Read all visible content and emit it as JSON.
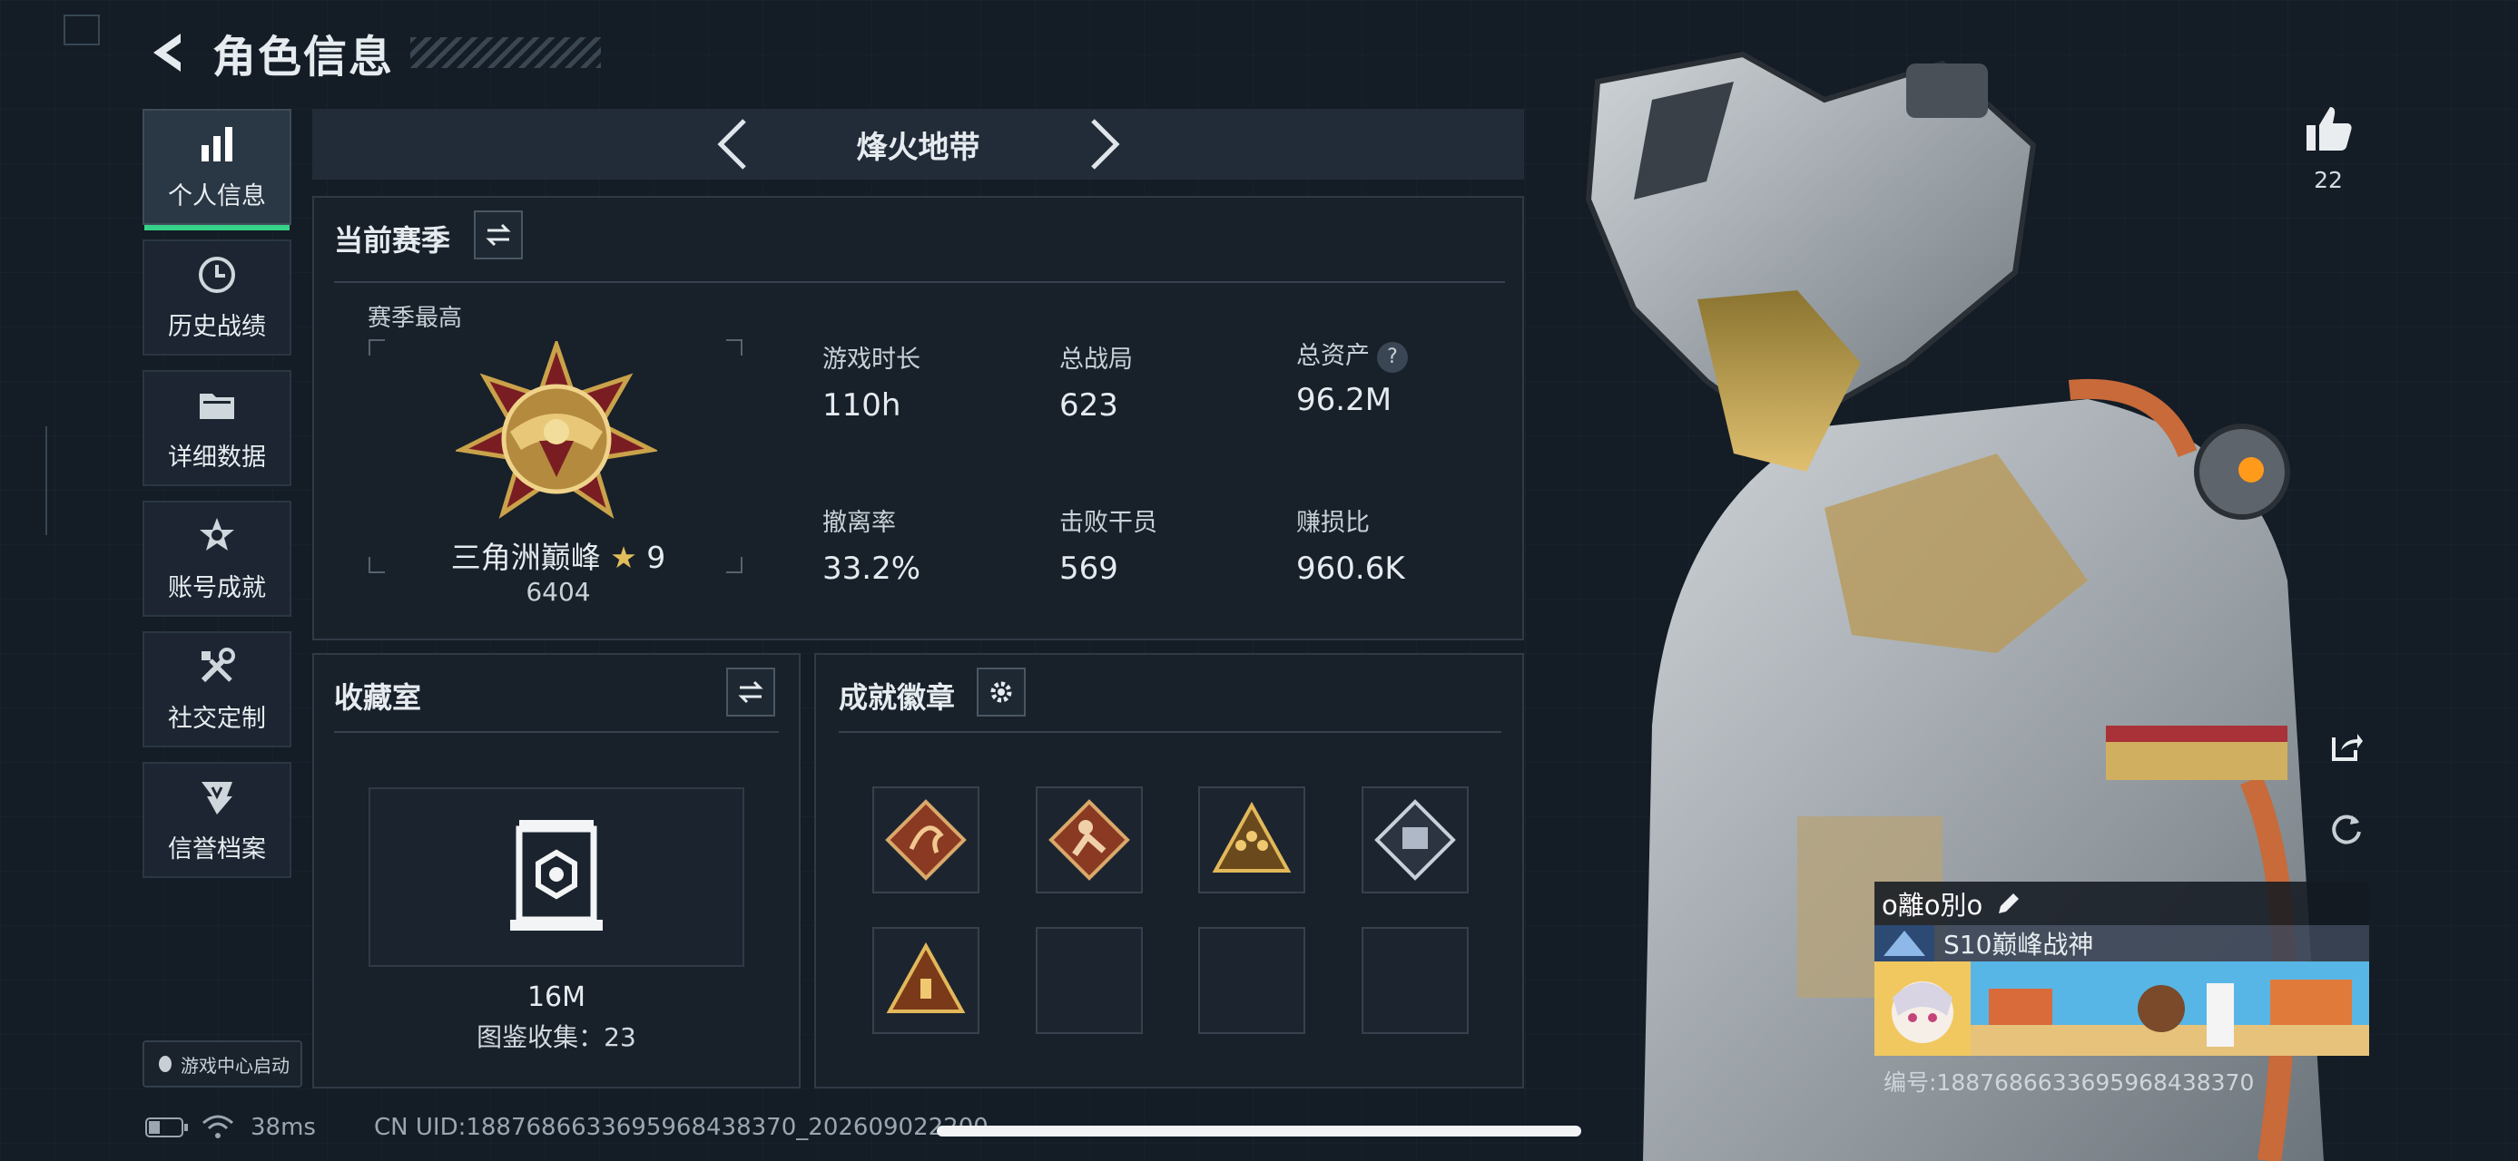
{
  "header": {
    "title": "角色信息"
  },
  "sidebar": {
    "items": [
      {
        "label": "个人信息",
        "icon": "bar-chart-icon",
        "active": true
      },
      {
        "label": "历史战绩",
        "icon": "clock-icon"
      },
      {
        "label": "详细数据",
        "icon": "folder-icon"
      },
      {
        "label": "账号成就",
        "icon": "achievement-star-icon"
      },
      {
        "label": "社交定制",
        "icon": "tools-icon"
      },
      {
        "label": "信誉档案",
        "icon": "credit-shield-icon"
      }
    ],
    "launch_label": "游戏中心启动"
  },
  "mode": {
    "title": "烽火地带"
  },
  "season": {
    "title": "当前赛季",
    "subtitle": "赛季最高",
    "rank_name": "三角洲巅峰",
    "rank_stars": "9",
    "rank_score": "6404",
    "stats": [
      {
        "label": "游戏时长",
        "value": "110h"
      },
      {
        "label": "总战局",
        "value": "623"
      },
      {
        "label": "总资产",
        "value": "96.2M",
        "help": "?"
      },
      {
        "label": "撤离率",
        "value": "33.2%"
      },
      {
        "label": "击败干员",
        "value": "569"
      },
      {
        "label": "赚损比",
        "value": "960.6K"
      }
    ]
  },
  "collection": {
    "title": "收藏室",
    "value": "16M",
    "count_text": "图鉴收集：23"
  },
  "badges": {
    "title": "成就徽章",
    "slots_filled": 5,
    "slots_total": 8
  },
  "profile": {
    "likes": "22",
    "name": "o離o別o",
    "title": "S10巅峰战神",
    "id_text": "编号:1887686633695968438370"
  },
  "status_bar": {
    "ping": "38ms",
    "uid": "CN UID:1887686633695968438370_202609022200"
  },
  "colors": {
    "accent_green": "#36d189",
    "background": "#141c26",
    "gold": "#c9a24a"
  }
}
